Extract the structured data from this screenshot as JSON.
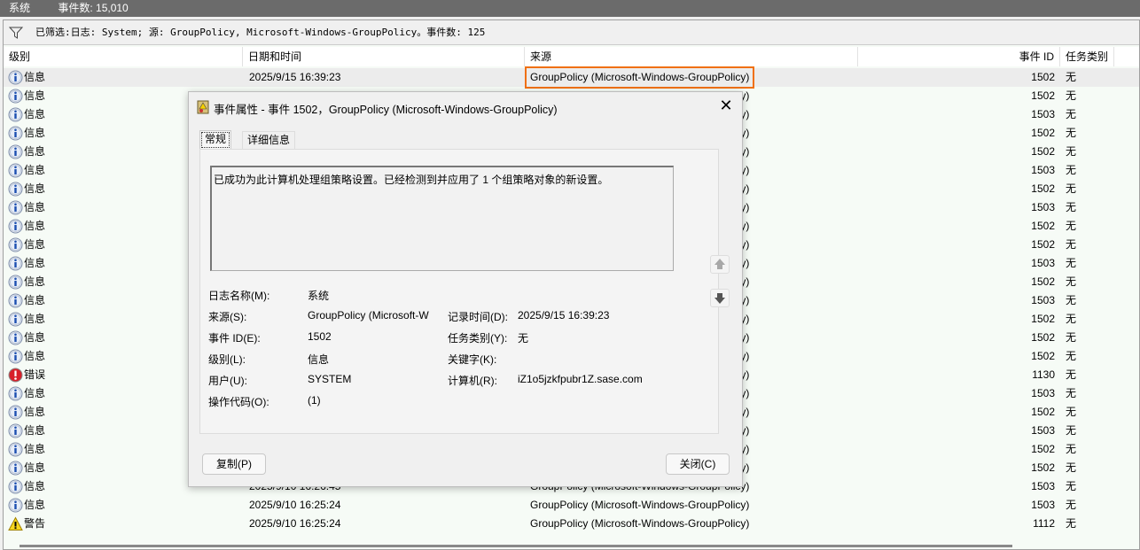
{
  "topbar": {
    "log": "系统",
    "count": "事件数: 15,010"
  },
  "filter": {
    "text": "已筛选:日志: System; 源: GroupPolicy, Microsoft-Windows-GroupPolicy。事件数: 125"
  },
  "columns": [
    "级别",
    "日期和时间",
    "来源",
    "事件 ID",
    "任务类别"
  ],
  "rows": [
    {
      "level": "信息",
      "type": "info",
      "date": "2025/9/15 16:39:23",
      "source": "GroupPolicy (Microsoft-Windows-GroupPolicy)",
      "id": "1502",
      "task": "无"
    },
    {
      "level": "信息",
      "type": "info",
      "date": "",
      "source": "GroupPolicy (Microsoft-Windows-GroupPolicy)",
      "id": "1502",
      "task": "无"
    },
    {
      "level": "信息",
      "type": "info",
      "date": "",
      "source": "GroupPolicy (Microsoft-Windows-GroupPolicy)",
      "id": "1503",
      "task": "无"
    },
    {
      "level": "信息",
      "type": "info",
      "date": "",
      "source": "GroupPolicy (Microsoft-Windows-GroupPolicy)",
      "id": "1502",
      "task": "无"
    },
    {
      "level": "信息",
      "type": "info",
      "date": "",
      "source": "GroupPolicy (Microsoft-Windows-GroupPolicy)",
      "id": "1502",
      "task": "无"
    },
    {
      "level": "信息",
      "type": "info",
      "date": "",
      "source": "GroupPolicy (Microsoft-Windows-GroupPolicy)",
      "id": "1503",
      "task": "无"
    },
    {
      "level": "信息",
      "type": "info",
      "date": "",
      "source": "GroupPolicy (Microsoft-Windows-GroupPolicy)",
      "id": "1502",
      "task": "无"
    },
    {
      "level": "信息",
      "type": "info",
      "date": "",
      "source": "GroupPolicy (Microsoft-Windows-GroupPolicy)",
      "id": "1503",
      "task": "无"
    },
    {
      "level": "信息",
      "type": "info",
      "date": "",
      "source": "GroupPolicy (Microsoft-Windows-GroupPolicy)",
      "id": "1502",
      "task": "无"
    },
    {
      "level": "信息",
      "type": "info",
      "date": "",
      "source": "GroupPolicy (Microsoft-Windows-GroupPolicy)",
      "id": "1502",
      "task": "无"
    },
    {
      "level": "信息",
      "type": "info",
      "date": "",
      "source": "GroupPolicy (Microsoft-Windows-GroupPolicy)",
      "id": "1503",
      "task": "无"
    },
    {
      "level": "信息",
      "type": "info",
      "date": "",
      "source": "GroupPolicy (Microsoft-Windows-GroupPolicy)",
      "id": "1502",
      "task": "无"
    },
    {
      "level": "信息",
      "type": "info",
      "date": "",
      "source": "GroupPolicy (Microsoft-Windows-GroupPolicy)",
      "id": "1503",
      "task": "无"
    },
    {
      "level": "信息",
      "type": "info",
      "date": "",
      "source": "GroupPolicy (Microsoft-Windows-GroupPolicy)",
      "id": "1502",
      "task": "无"
    },
    {
      "level": "信息",
      "type": "info",
      "date": "",
      "source": "GroupPolicy (Microsoft-Windows-GroupPolicy)",
      "id": "1502",
      "task": "无"
    },
    {
      "level": "信息",
      "type": "info",
      "date": "",
      "source": "GroupPolicy (Microsoft-Windows-GroupPolicy)",
      "id": "1502",
      "task": "无"
    },
    {
      "level": "错误",
      "type": "error",
      "date": "",
      "source": "GroupPolicy (Microsoft-Windows-GroupPolicy)",
      "id": "1130",
      "task": "无"
    },
    {
      "level": "信息",
      "type": "info",
      "date": "",
      "source": "GroupPolicy (Microsoft-Windows-GroupPolicy)",
      "id": "1503",
      "task": "无"
    },
    {
      "level": "信息",
      "type": "info",
      "date": "",
      "source": "GroupPolicy (Microsoft-Windows-GroupPolicy)",
      "id": "1502",
      "task": "无"
    },
    {
      "level": "信息",
      "type": "info",
      "date": "",
      "source": "GroupPolicy (Microsoft-Windows-GroupPolicy)",
      "id": "1503",
      "task": "无"
    },
    {
      "level": "信息",
      "type": "info",
      "date": "",
      "source": "GroupPolicy (Microsoft-Windows-GroupPolicy)",
      "id": "1502",
      "task": "无"
    },
    {
      "level": "信息",
      "type": "info",
      "date": "",
      "source": "GroupPolicy (Microsoft-Windows-GroupPolicy)",
      "id": "1502",
      "task": "无"
    },
    {
      "level": "信息",
      "type": "info",
      "date": "2025/9/10 16:26:45",
      "source": "GroupPolicy (Microsoft-Windows-GroupPolicy)",
      "id": "1503",
      "task": "无"
    },
    {
      "level": "信息",
      "type": "info",
      "date": "2025/9/10 16:25:24",
      "source": "GroupPolicy (Microsoft-Windows-GroupPolicy)",
      "id": "1503",
      "task": "无"
    },
    {
      "level": "警告",
      "type": "warning",
      "date": "2025/9/10 16:25:24",
      "source": "GroupPolicy (Microsoft-Windows-GroupPolicy)",
      "id": "1112",
      "task": "无"
    }
  ],
  "dialog": {
    "title": "事件属性 - 事件 1502，GroupPolicy (Microsoft-Windows-GroupPolicy)",
    "tabs": [
      "常规",
      "详细信息"
    ],
    "message": "已成功为此计算机处理组策略设置。已经检测到并应用了 1 个组策略对象的新设置。",
    "fields": {
      "log_name_label": "日志名称(M):",
      "log_name": "系统",
      "source_label": "来源(S):",
      "source": "GroupPolicy (Microsoft-W",
      "logged_label": "记录时间(D):",
      "logged": "2025/9/15 16:39:23",
      "event_id_label": "事件 ID(E):",
      "event_id": "1502",
      "task_label": "任务类别(Y):",
      "task": "无",
      "level_label": "级别(L):",
      "level": "信息",
      "keywords_label": "关键字(K):",
      "keywords": "",
      "user_label": "用户(U):",
      "user": "SYSTEM",
      "computer_label": "计算机(R):",
      "computer": "iZ1o5jzkfpubr1Z.sase.com",
      "opcode_label": "操作代码(O):",
      "opcode": "(1)"
    },
    "copy_label": "复制(P)",
    "close_label": "关闭(C)"
  },
  "colors": {
    "highlight": "#f07010",
    "topbar": "#6b6b6b"
  }
}
